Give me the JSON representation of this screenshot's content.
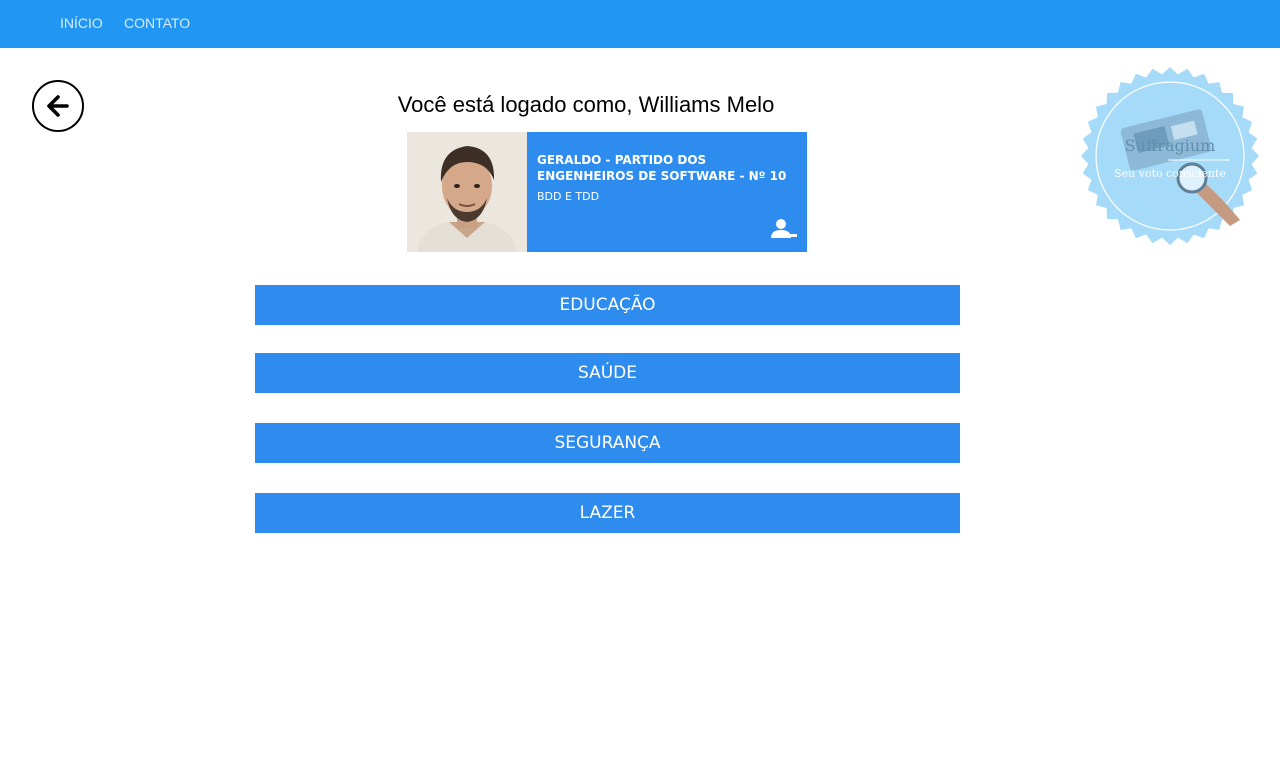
{
  "nav": {
    "inicio": "INÍCIO",
    "contato": "CONTATO"
  },
  "header": {
    "logged_as": "Você está logado como, Williams Melo"
  },
  "candidate": {
    "name": "GERALDO - PARTIDO DOS ENGENHEIROS DE SOFTWARE - Nº 10",
    "description": "BDD E TDD",
    "action_icon": "remove-user-icon"
  },
  "categories": [
    "EDUCAÇÃO",
    "SAÚDE",
    "SEGURANÇA",
    "LAZER"
  ],
  "seal": {
    "name": "Suffragium",
    "slogan": "Seu voto consciente"
  },
  "colors": {
    "navbar": "#2196f3",
    "accent": "#2d8ced",
    "seal": "#a6daf9"
  },
  "icons": {
    "back": "arrow-left-icon"
  }
}
